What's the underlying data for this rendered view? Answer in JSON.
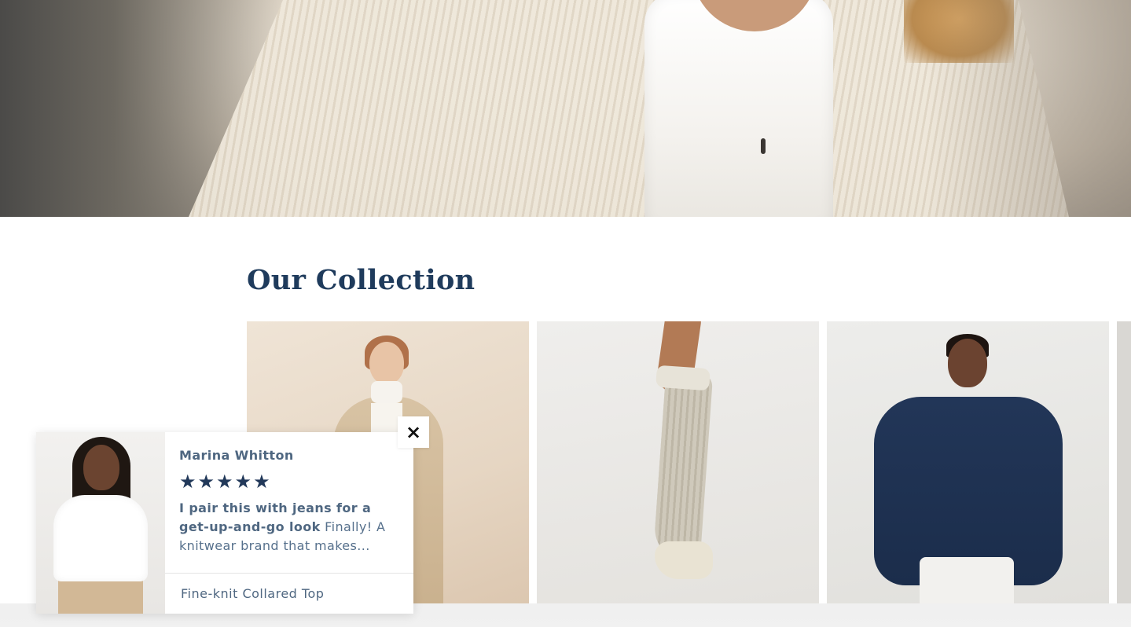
{
  "collection": {
    "title": "Our Collection",
    "products": [
      {
        "name": "camel-wrap-cardigan"
      },
      {
        "name": "ribbed-knee-sock"
      },
      {
        "name": "navy-poncho-sweater"
      },
      {
        "name": "partial-product"
      }
    ]
  },
  "review_popup": {
    "reviewer_name": "Marina Whitton",
    "rating": 5,
    "stars": [
      "★",
      "★",
      "★",
      "★",
      "★"
    ],
    "headline": "I pair this with jeans for a get-up-and-go look",
    "excerpt": " Finally! A knitwear brand that makes...",
    "product_name": "Fine-knit Collared Top",
    "close_icon": "×"
  },
  "colors": {
    "heading": "#1f3b5c",
    "star": "#22395a",
    "text": "#56708c"
  }
}
